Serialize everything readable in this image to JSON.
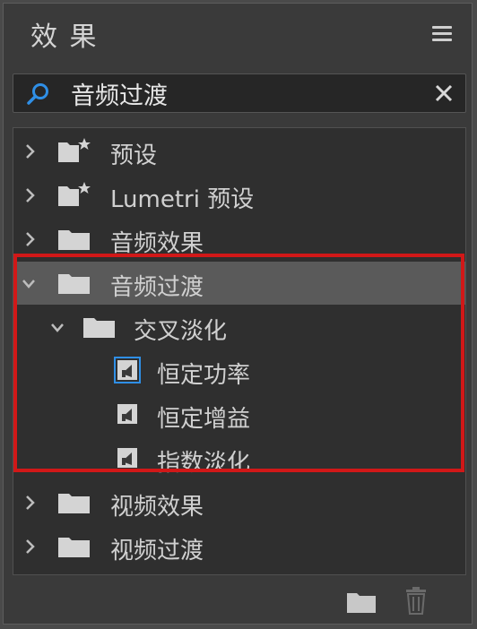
{
  "panel": {
    "title": "效 果"
  },
  "search": {
    "value": "音频过渡",
    "placeholder": ""
  },
  "tree": {
    "items": [
      {
        "label": "预设",
        "icon": "preset-folder-icon",
        "expanded": false
      },
      {
        "label": "Lumetri 预设",
        "icon": "preset-folder-icon",
        "expanded": false
      },
      {
        "label": "音频效果",
        "icon": "folder-icon",
        "expanded": false
      },
      {
        "label": "音频过渡",
        "icon": "folder-icon",
        "expanded": true,
        "selected": true
      },
      {
        "label": "交叉淡化",
        "icon": "folder-icon",
        "expanded": true
      },
      {
        "label": "恒定功率",
        "icon": "audio-transition-icon",
        "active": true
      },
      {
        "label": "恒定增益",
        "icon": "audio-transition-icon"
      },
      {
        "label": "指数淡化",
        "icon": "audio-transition-icon"
      },
      {
        "label": "视频效果",
        "icon": "folder-icon",
        "expanded": false
      },
      {
        "label": "视频过渡",
        "icon": "folder-icon",
        "expanded": false
      }
    ]
  },
  "colors": {
    "highlight_border": "#d11818",
    "accent_blue": "#2f8fe6"
  }
}
